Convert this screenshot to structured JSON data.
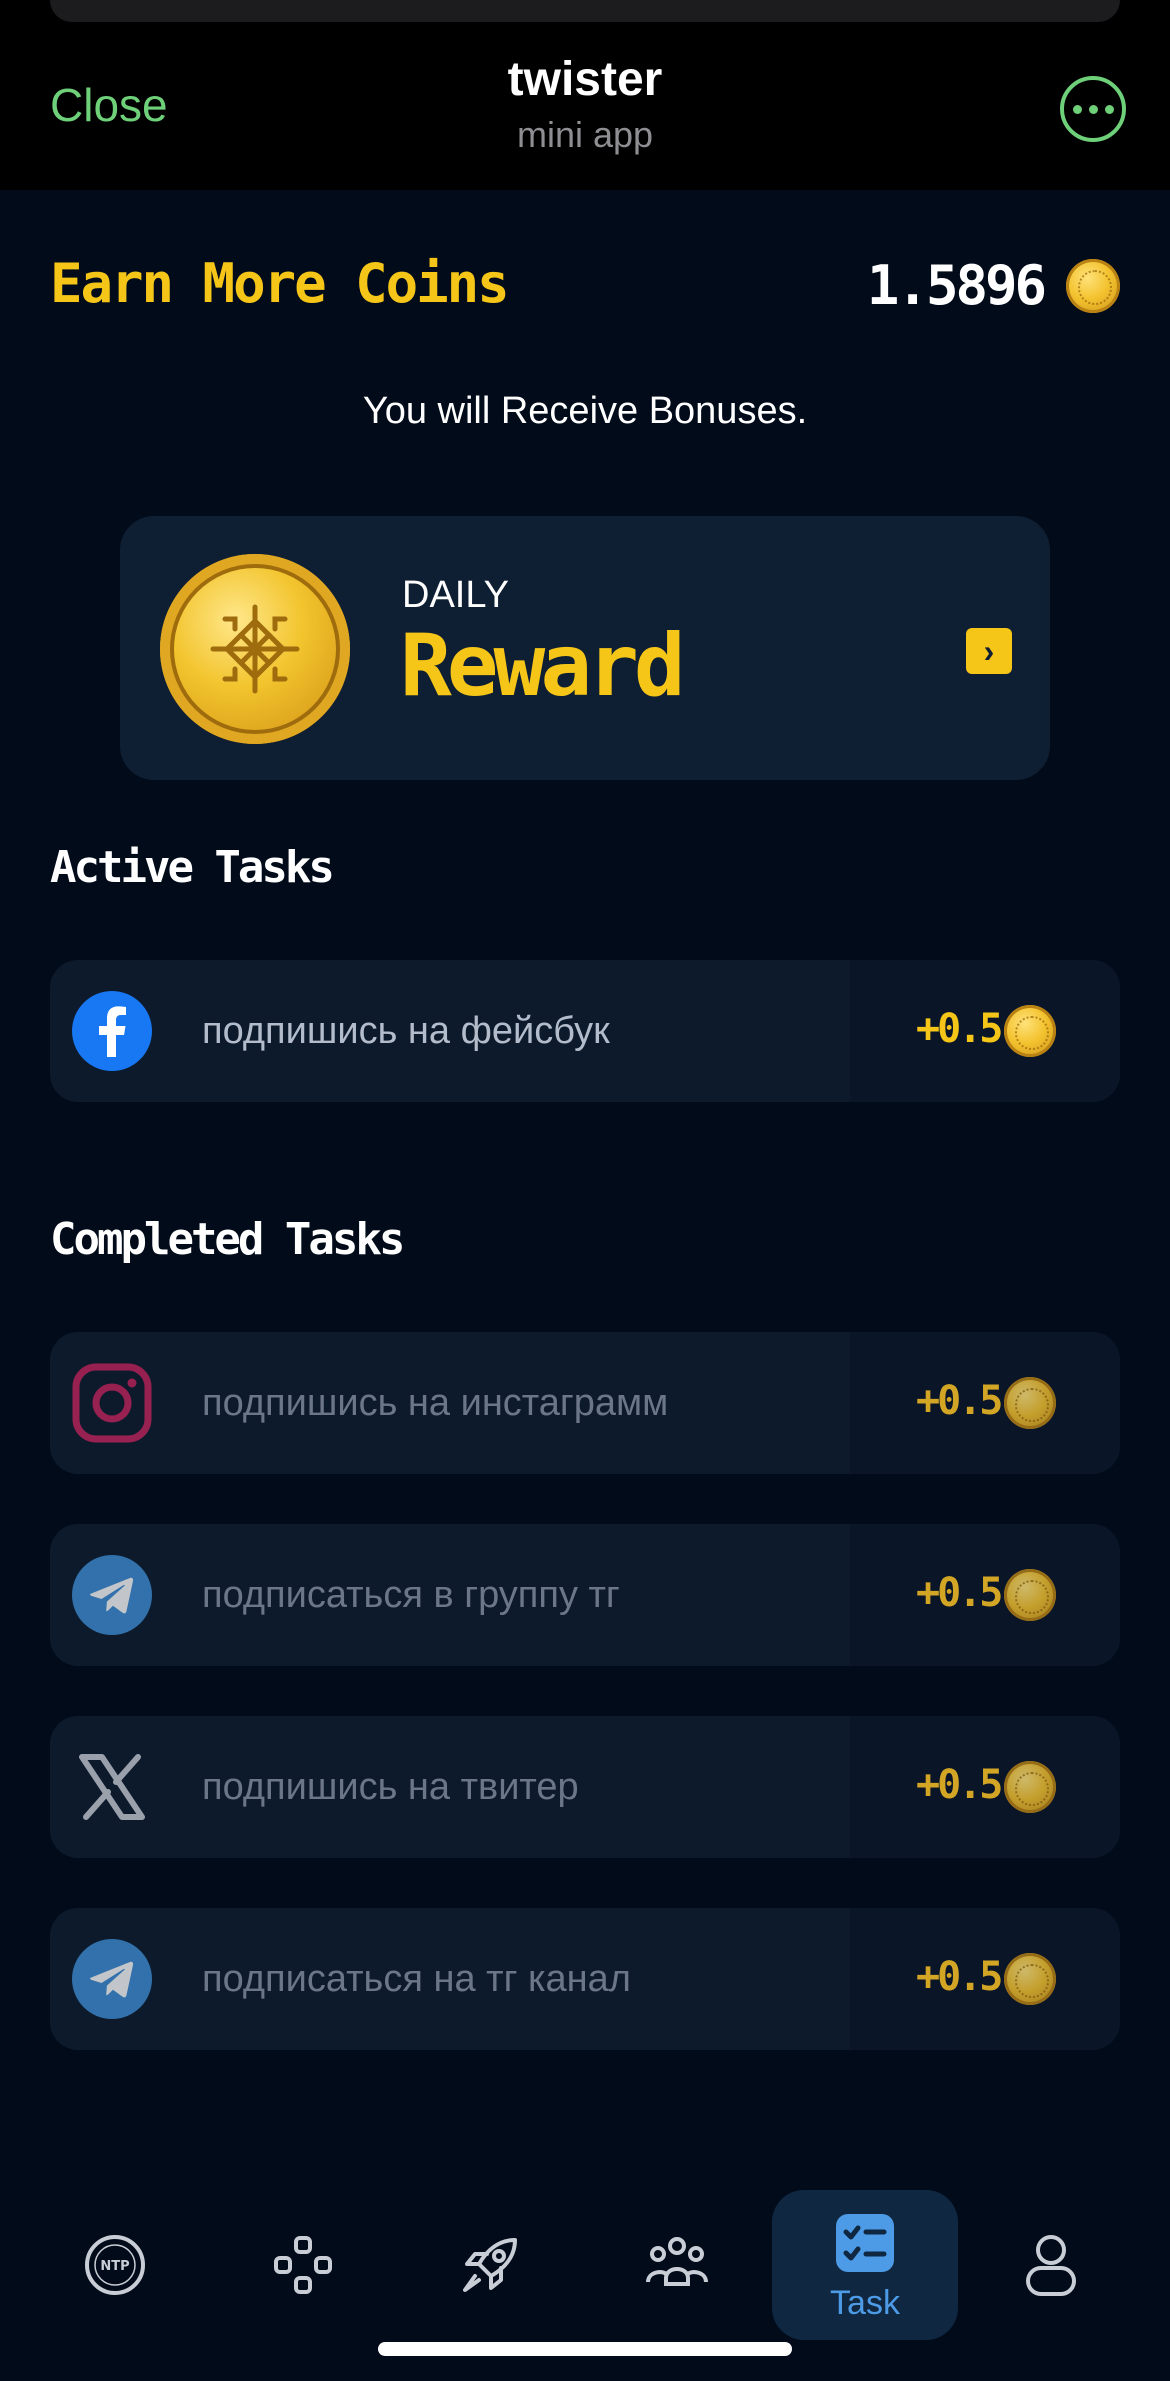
{
  "header": {
    "close_label": "Close",
    "app_name": "twister",
    "app_subtitle": "mini app",
    "more_icon": "more-dots-icon"
  },
  "main": {
    "title": "Earn More Coins",
    "balance": "1.5896",
    "subtitle": "You will Receive Bonuses.",
    "daily": {
      "small_label": "DAILY",
      "big_label": "Reward",
      "chevron": "›"
    }
  },
  "active_tasks": {
    "title": "Active Tasks",
    "items": [
      {
        "label": "подпишись на фейсбук",
        "amount": "+0.5",
        "icon": "facebook-icon"
      }
    ]
  },
  "completed_tasks": {
    "title": "Completed Tasks",
    "items": [
      {
        "label": "подпишись на инстаграмм",
        "amount": "+0.5",
        "icon": "instagram-icon"
      },
      {
        "label": "подписаться в группу тг",
        "amount": "+0.5",
        "icon": "telegram-icon"
      },
      {
        "label": "подпишись на твитер",
        "amount": "+0.5",
        "icon": "x-twitter-icon"
      },
      {
        "label": "подписаться на тг канал",
        "amount": "+0.5",
        "icon": "telegram-icon"
      }
    ]
  },
  "nav": {
    "items": [
      {
        "icon": "ntp-icon",
        "label": "NTP"
      },
      {
        "icon": "gamepad-icon"
      },
      {
        "icon": "rocket-icon"
      },
      {
        "icon": "group-icon"
      },
      {
        "icon": "task-icon",
        "label": "Task",
        "active": true
      },
      {
        "icon": "profile-icon"
      }
    ]
  },
  "colors": {
    "background": "#020b1a",
    "accent_gold": "#f5c518",
    "telegram_green": "#6fd07a",
    "active_blue": "#4d9be6"
  }
}
